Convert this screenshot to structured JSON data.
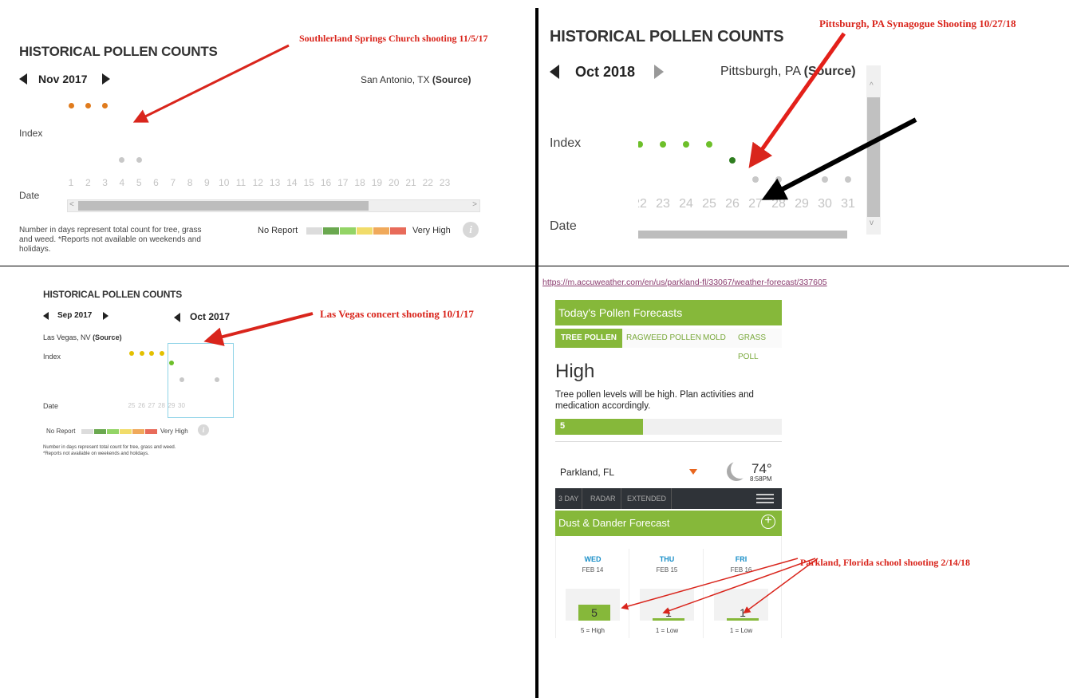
{
  "panels": {
    "texas": {
      "title": "HISTORICAL POLLEN COUNTS",
      "month": "Nov 2017",
      "location": "San Antonio, TX",
      "source": "(Source)",
      "index_label": "Index",
      "date_label": "Date",
      "days": [
        "1",
        "2",
        "3",
        "4",
        "5",
        "6",
        "7",
        "8",
        "9",
        "10",
        "11",
        "12",
        "13",
        "14",
        "15",
        "16",
        "17",
        "18",
        "19",
        "20",
        "21",
        "22",
        "23"
      ],
      "index_values": [
        {
          "day": 1,
          "level": "high"
        },
        {
          "day": 2,
          "level": "high"
        },
        {
          "day": 3,
          "level": "high"
        },
        {
          "day": 4,
          "level": "no-report"
        },
        {
          "day": 5,
          "level": "no-report"
        }
      ],
      "footnote": "Number in days represent total count for tree, grass and weed. *Reports not available on weekends and holidays.",
      "legend_low": "No Report",
      "legend_high": "Very High",
      "annotation": "Southlerland Springs Church shooting 11/5/17"
    },
    "pittsburgh": {
      "title": "HISTORICAL POLLEN COUNTS",
      "month": "Oct 2018",
      "location": "Pittsburgh, PA",
      "source": "(Source)",
      "index_label": "Index",
      "date_label": "Date",
      "days": [
        "22",
        "23",
        "24",
        "25",
        "26",
        "27",
        "28",
        "29",
        "30",
        "31"
      ],
      "index_values": [
        {
          "day": 22,
          "level": "moderate"
        },
        {
          "day": 23,
          "level": "moderate"
        },
        {
          "day": 24,
          "level": "moderate"
        },
        {
          "day": 25,
          "level": "moderate"
        },
        {
          "day": 26,
          "level": "low-moderate"
        },
        {
          "day": 27,
          "level": "no-report"
        },
        {
          "day": 28,
          "level": "no-report"
        },
        {
          "day": 30,
          "level": "no-report"
        },
        {
          "day": 31,
          "level": "no-report"
        }
      ],
      "annotation": "Pittsburgh, PA Synagogue Shooting 10/27/18"
    },
    "vegas": {
      "title": "HISTORICAL POLLEN COUNTS",
      "month_left": "Sep 2017",
      "month_right": "Oct 2017",
      "location": "Las Vegas, NV",
      "source": "(Source)",
      "index_label": "Index",
      "date_label": "Date",
      "days": [
        "25",
        "26",
        "27",
        "28",
        "29",
        "30"
      ],
      "index_values": [
        {
          "day": 25,
          "level": "moderate-high"
        },
        {
          "day": 26,
          "level": "moderate-high"
        },
        {
          "day": 27,
          "level": "moderate-high"
        },
        {
          "day": 28,
          "level": "moderate-high"
        },
        {
          "day": 29,
          "level": "moderate"
        },
        {
          "day": 30,
          "level": "no-report"
        }
      ],
      "legend_low": "No Report",
      "legend_high": "Very High",
      "footnote_1": "Number in days represent total count for tree, grass and weed.",
      "footnote_2": "*Reports not available on weekends and holidays.",
      "annotation": "Las Vegas concert shooting 10/1/17"
    },
    "parkland": {
      "url": "https://m.accuweather.com/en/us/parkland-fl/33067/weather-forecast/337605",
      "header": "Today's Pollen Forecasts",
      "tabs": [
        "TREE POLLEN",
        "RAGWEED POLLEN",
        "MOLD",
        "GRASS POLL"
      ],
      "level": "High",
      "description": "Tree pollen levels will be high. Plan activities and medication accordingly.",
      "bar_value": "5",
      "bar_fraction": 0.5,
      "city": "Parkland, FL",
      "temp": "74°",
      "time": "8:58PM",
      "nav": [
        "3 DAY",
        "RADAR",
        "EXTENDED"
      ],
      "dust_header": "Dust & Dander Forecast",
      "forecast": [
        {
          "dow": "WED",
          "date": "FEB 14",
          "value": "5",
          "caption": "5 = High"
        },
        {
          "dow": "THU",
          "date": "FEB 15",
          "value": "1",
          "caption": "1 = Low"
        },
        {
          "dow": "FRI",
          "date": "FEB 16",
          "value": "1",
          "caption": "1 = Low"
        }
      ],
      "annotation": "Parkland, Florida school shooting 2/14/18"
    }
  },
  "colors": {
    "high": "#e07b1d",
    "moderate": "#6dbf2a",
    "low-moderate": "#2e7d1f",
    "moderate-high": "#e3c000",
    "no-report": "#c8c8c8",
    "annotation": "#d9251c",
    "accent_green": "#86b83a"
  },
  "legend_colors": [
    "#dcdcdc",
    "#6aa84f",
    "#93d466",
    "#f1dc6a",
    "#f0a95b",
    "#e86b5a"
  ]
}
